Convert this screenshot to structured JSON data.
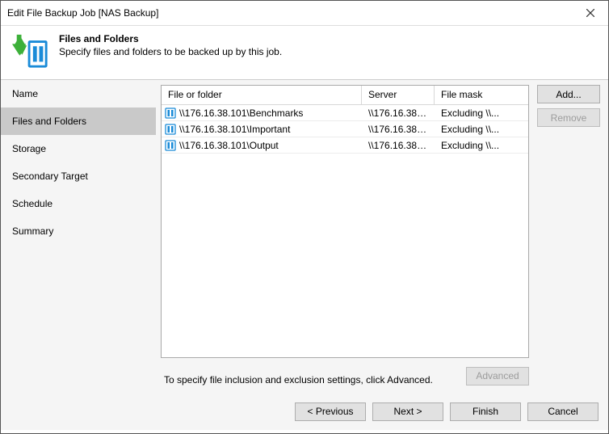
{
  "window": {
    "title": "Edit File Backup Job [NAS Backup]"
  },
  "header": {
    "title": "Files and Folders",
    "subtitle": "Specify files and folders to be backed up by this job."
  },
  "sidebar": {
    "items": [
      {
        "label": "Name"
      },
      {
        "label": "Files and Folders"
      },
      {
        "label": "Storage"
      },
      {
        "label": "Secondary Target"
      },
      {
        "label": "Schedule"
      },
      {
        "label": "Summary"
      }
    ],
    "activeIndex": 1
  },
  "table": {
    "columns": {
      "path": "File or folder",
      "server": "Server",
      "mask": "File mask"
    },
    "rows": [
      {
        "path": "\\\\176.16.38.101\\Benchmarks",
        "server": "\\\\176.16.38.1...",
        "mask": "Excluding \\\\..."
      },
      {
        "path": "\\\\176.16.38.101\\Important",
        "server": "\\\\176.16.38.1...",
        "mask": "Excluding \\\\..."
      },
      {
        "path": "\\\\176.16.38.101\\Output",
        "server": "\\\\176.16.38.1...",
        "mask": "Excluding \\\\..."
      }
    ]
  },
  "buttons": {
    "add": "Add...",
    "remove": "Remove",
    "advanced": "Advanced",
    "previous": "< Previous",
    "next": "Next >",
    "finish": "Finish",
    "cancel": "Cancel"
  },
  "hint": "To specify file inclusion and exclusion settings, click Advanced."
}
